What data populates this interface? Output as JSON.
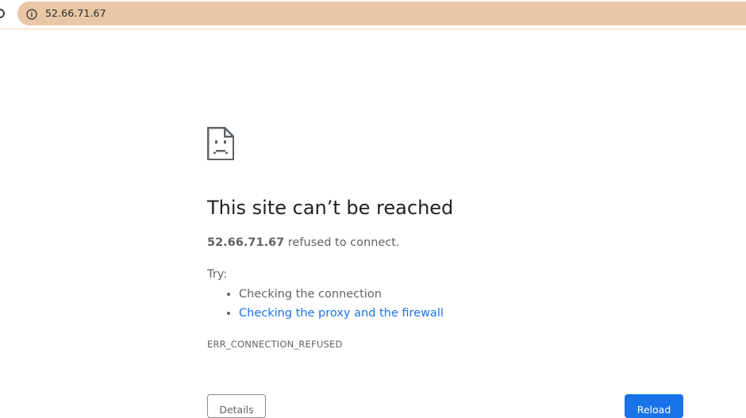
{
  "browser": {
    "url": "52.66.71.67",
    "icons": {
      "reload": "reload-icon",
      "site_info": "info-icon"
    },
    "colors": {
      "omnibox_bg": "#e8c6a6"
    }
  },
  "error_page": {
    "icon": "sad-page-icon",
    "title": "This site can’t be reached",
    "host": "52.66.71.67",
    "message": "refused to connect.",
    "try_label": "Try:",
    "suggestions": [
      {
        "text": "Checking the connection",
        "is_link": false
      },
      {
        "text": "Checking the proxy and the firewall",
        "is_link": true
      }
    ],
    "error_code": "ERR_CONNECTION_REFUSED",
    "buttons": {
      "details": "Details",
      "reload": "Reload"
    },
    "colors": {
      "link": "#1a73e8",
      "primary_button": "#1a73e8",
      "text": "#5f6368",
      "title": "#202124"
    }
  }
}
